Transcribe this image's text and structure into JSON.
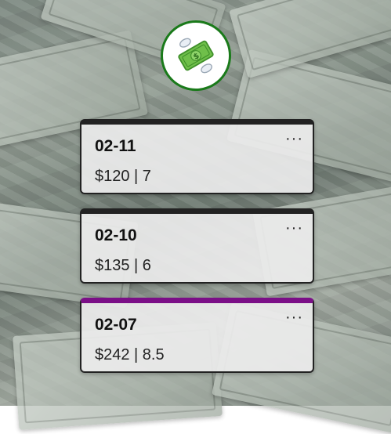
{
  "header": {
    "avatar_icon": "money-with-wings-icon"
  },
  "entries": [
    {
      "date": "02-11",
      "summary": "$120 | 7",
      "menu": "···",
      "accent": "#222222"
    },
    {
      "date": "02-10",
      "summary": "$135 | 6",
      "menu": "···",
      "accent": "#222222"
    },
    {
      "date": "02-07",
      "summary": "$242 | 8.5",
      "menu": "···",
      "accent": "#7b0f87"
    }
  ],
  "colors": {
    "avatar_border": "#1a7a1a",
    "highlight": "#7b0f87"
  }
}
